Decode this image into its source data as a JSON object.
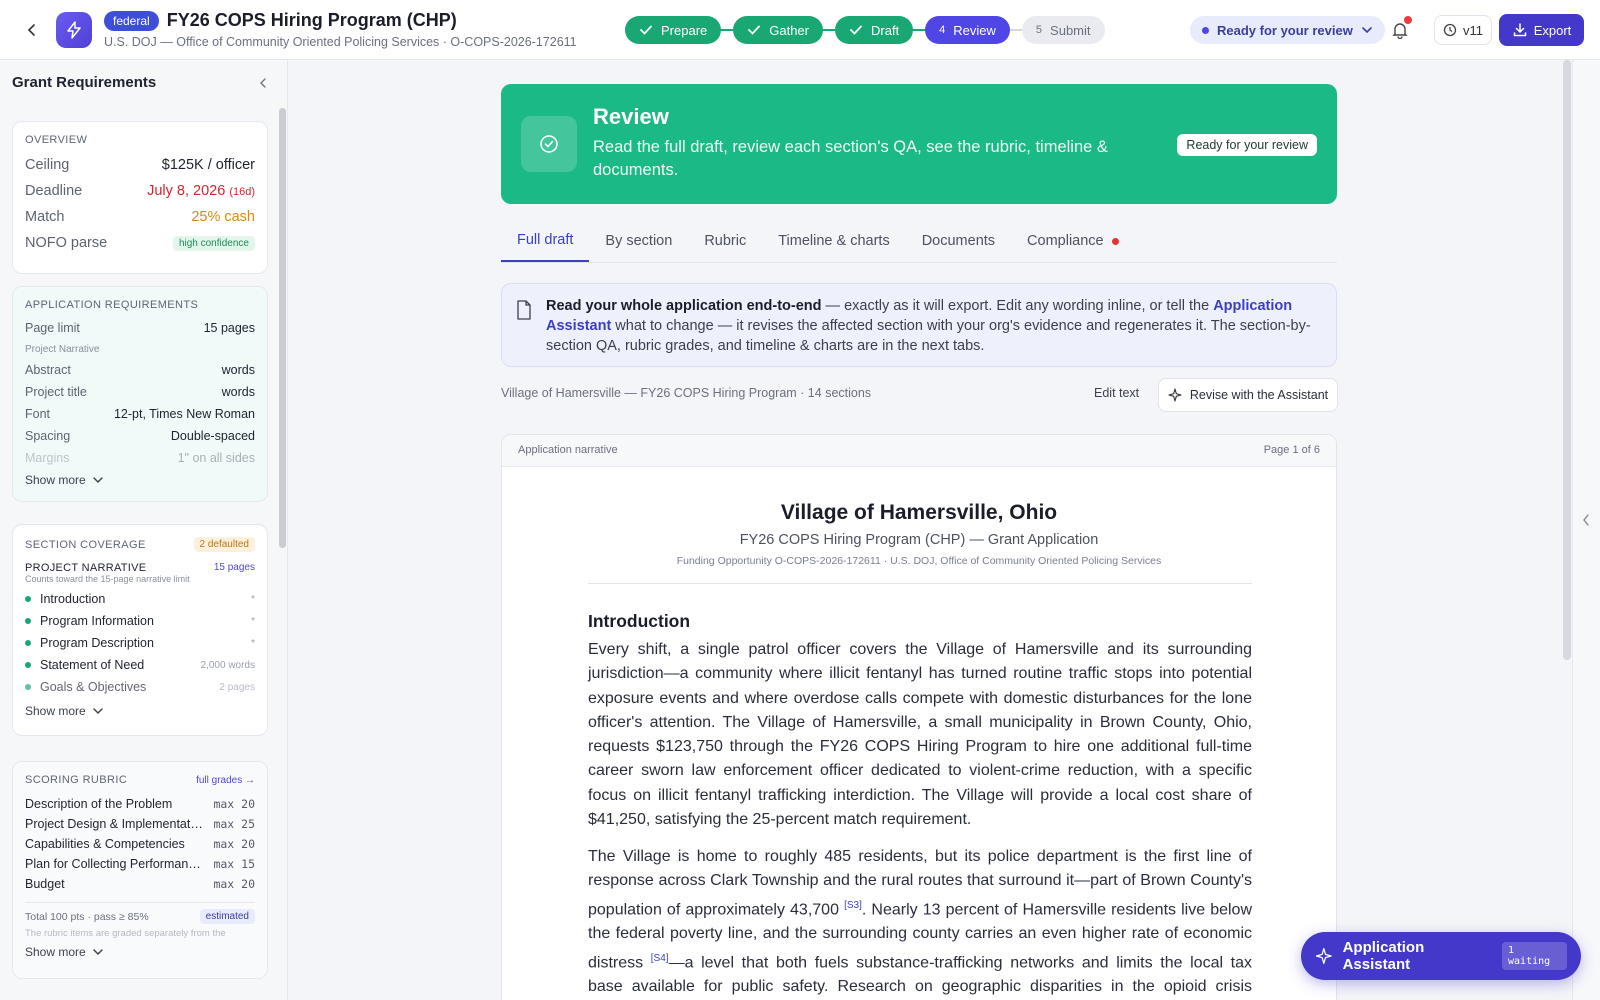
{
  "header": {
    "badge": "federal",
    "title": "FY26 COPS Hiring Program (CHP)",
    "subtitle": "U.S. DOJ — Office of Community Oriented Policing Services · O-COPS-2026-172611",
    "steps": [
      {
        "num": "1",
        "label": "Prepare",
        "state": "done"
      },
      {
        "num": "2",
        "label": "Gather",
        "state": "done"
      },
      {
        "num": "3",
        "label": "Draft",
        "state": "done"
      },
      {
        "num": "4",
        "label": "Review",
        "state": "current"
      },
      {
        "num": "5",
        "label": "Submit",
        "state": "todo"
      }
    ],
    "status": "Ready for your review",
    "version": "v11",
    "export": "Export"
  },
  "sidebar": {
    "title": "Grant Requirements",
    "overview": {
      "title": "Overview",
      "ceiling_k": "Ceiling",
      "ceiling_v": "$125K / officer",
      "deadline_k": "Deadline",
      "deadline_v": "July 8, 2026",
      "deadline_days": "(16d)",
      "match_k": "Match",
      "match_v": "25% cash",
      "nofo_k": "NOFO parse",
      "nofo_v": "high confidence"
    },
    "app_req": {
      "title": "Application requirements",
      "page_limit_k": "Page limit",
      "page_limit_v": "15 pages",
      "page_limit_sub": "Project Narrative",
      "abstract_k": "Abstract",
      "abstract_v": "words",
      "project_title_k": "Project title",
      "project_title_v": "words",
      "font_k": "Font",
      "font_v": "12-pt, Times New Roman",
      "spacing_k": "Spacing",
      "spacing_v": "Double-spaced",
      "margins_k": "Margins",
      "margins_v": "1\" on all sides",
      "show_more": "Show more"
    },
    "coverage": {
      "title": "Section coverage",
      "badge": "2 defaulted",
      "group": "PROJECT NARRATIVE",
      "group_pages": "15 pages",
      "group_note": "Counts toward the 15-page narrative limit",
      "items": [
        {
          "name": "Introduction",
          "meta": "*"
        },
        {
          "name": "Program Information",
          "meta": "*"
        },
        {
          "name": "Program Description",
          "meta": "*"
        },
        {
          "name": "Statement of Need",
          "meta": "2,000 words"
        },
        {
          "name": "Goals & Objectives",
          "meta": "2 pages"
        }
      ],
      "show_more": "Show more"
    },
    "rubric": {
      "title": "Scoring rubric",
      "link": "full grades →",
      "items": [
        {
          "name": "Description of the Problem",
          "max": "max 20"
        },
        {
          "name": "Project Design & Implementation",
          "max": "max 25"
        },
        {
          "name": "Capabilities & Competencies",
          "max": "max 20"
        },
        {
          "name": "Plan for Collecting Performance Data",
          "max": "max 15"
        },
        {
          "name": "Budget",
          "max": "max 20"
        }
      ],
      "total": "Total 100 pts · pass ≥ 85%",
      "total_badge": "estimated",
      "note": "The rubric items are graded separately from the",
      "show_more": "Show more"
    }
  },
  "banner": {
    "title": "Review",
    "text": "Read the full draft, review each section's QA, see the rubric, timeline & documents.",
    "pill": "Ready for your review"
  },
  "tabs": [
    "Full draft",
    "By section",
    "Rubric",
    "Timeline & charts",
    "Documents",
    "Compliance"
  ],
  "info": {
    "bold": "Read your whole application end-to-end",
    "t1": " — exactly as it will export. Edit any wording inline, or tell the ",
    "link": "Application Assistant",
    "t2": " what to change — it revises the affected section with your org's evidence and regenerates it. The section-by-section QA, rubric grades, and timeline & charts are in the next tabs."
  },
  "meta_line": "Village of Hamersville — FY26 COPS Hiring Program · 14 sections",
  "edit_text": "Edit text",
  "revise": "Revise with the Assistant",
  "doc": {
    "header_left": "Application narrative",
    "header_right": "Page 1 of 6",
    "h1": "Village of Hamersville, Ohio",
    "h2": "FY26 COPS Hiring Program (CHP) — Grant Application",
    "h3": "Funding Opportunity O-COPS-2026-172611 · U.S. DOJ, Office of Community Oriented Policing Services",
    "section": "Introduction",
    "p1": "Every shift, a single patrol officer covers the Village of Hamersville and its surrounding jurisdiction—a community where illicit fentanyl has turned routine traffic stops into potential exposure events and where overdose calls compete with domestic disturbances for the lone officer's attention. The Village of Hamersville, a small municipality in Brown County, Ohio, requests $123,750 through the FY26 COPS Hiring Program to hire one additional full-time career sworn law enforcement officer dedicated to violent-crime reduction, with a specific focus on illicit fentanyl trafficking interdiction. The Village will provide a local cost share of $41,250, satisfying the 25-percent match requirement.",
    "p2a": "The Village is home to roughly 485 residents, but its police department is the first line of response across Clark Township and the rural routes that surround it—part of Brown County's population of approximately 43,700 ",
    "cite1": "[S3]",
    "p2b": ". Nearly 13 percent of Hamersville residents live below the federal poverty line, and the surrounding county carries an even higher rate of economic distress ",
    "cite2": "[S4]",
    "p2c": "—a level that both fuels substance-trafficking networks and limits the local tax base available for public safety. Research on geographic disparities in the opioid crisis confirms that rural"
  },
  "assistant": {
    "label": "Application Assistant",
    "waiting": "1 waiting"
  }
}
